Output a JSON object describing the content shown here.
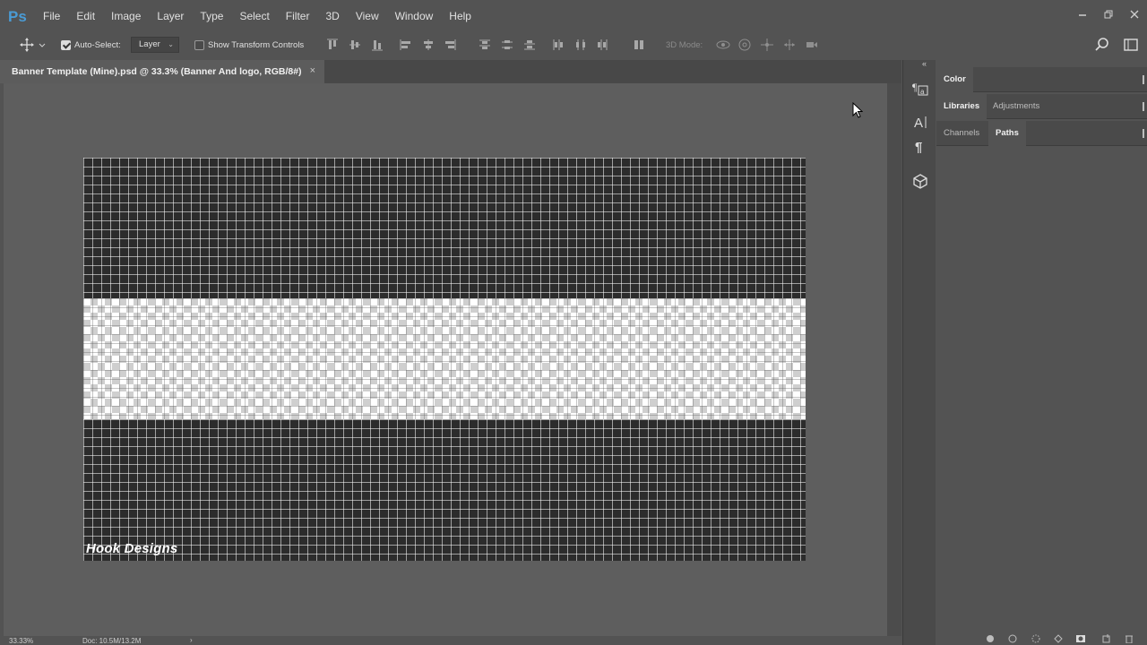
{
  "app": {
    "logo": "Ps"
  },
  "menu": [
    "File",
    "Edit",
    "Image",
    "Layer",
    "Type",
    "Select",
    "Filter",
    "3D",
    "View",
    "Window",
    "Help"
  ],
  "options": {
    "auto_select_label": "Auto-Select:",
    "auto_select_checked": true,
    "auto_select_target": "Layer",
    "show_transform_label": "Show Transform Controls",
    "show_transform_checked": false,
    "mode_3d_label": "3D Mode:"
  },
  "document": {
    "tab_title": "Banner Template (Mine).psd @ 33.3% (Banner And logo, RGB/8#)",
    "close_glyph": "×",
    "logo_text": "Hook Designs"
  },
  "status": {
    "zoom": "33.33%",
    "doc_size": "Doc: 10.5M/13.2M",
    "arrow": "›"
  },
  "panels": {
    "collapse_glyph": "«",
    "group1": [
      {
        "label": "Color",
        "active": true
      }
    ],
    "group2": [
      {
        "label": "Libraries",
        "active": true
      },
      {
        "label": "Adjustments",
        "active": false
      }
    ],
    "group3": [
      {
        "label": "Channels",
        "active": false
      },
      {
        "label": "Paths",
        "active": true
      }
    ]
  },
  "icons": {
    "strip": [
      "character-paragraph-styles-icon",
      "character-icon",
      "paragraph-icon",
      "3d-icon"
    ],
    "footer": [
      "fill-path-icon",
      "stroke-path-icon",
      "load-selection-icon",
      "make-work-path-icon",
      "add-mask-icon",
      "new-path-icon",
      "delete-path-icon"
    ]
  },
  "colors": {
    "accent": "#4a9cd6",
    "ui_bg": "#535353",
    "canvas_bg": "#5e5e5e"
  }
}
